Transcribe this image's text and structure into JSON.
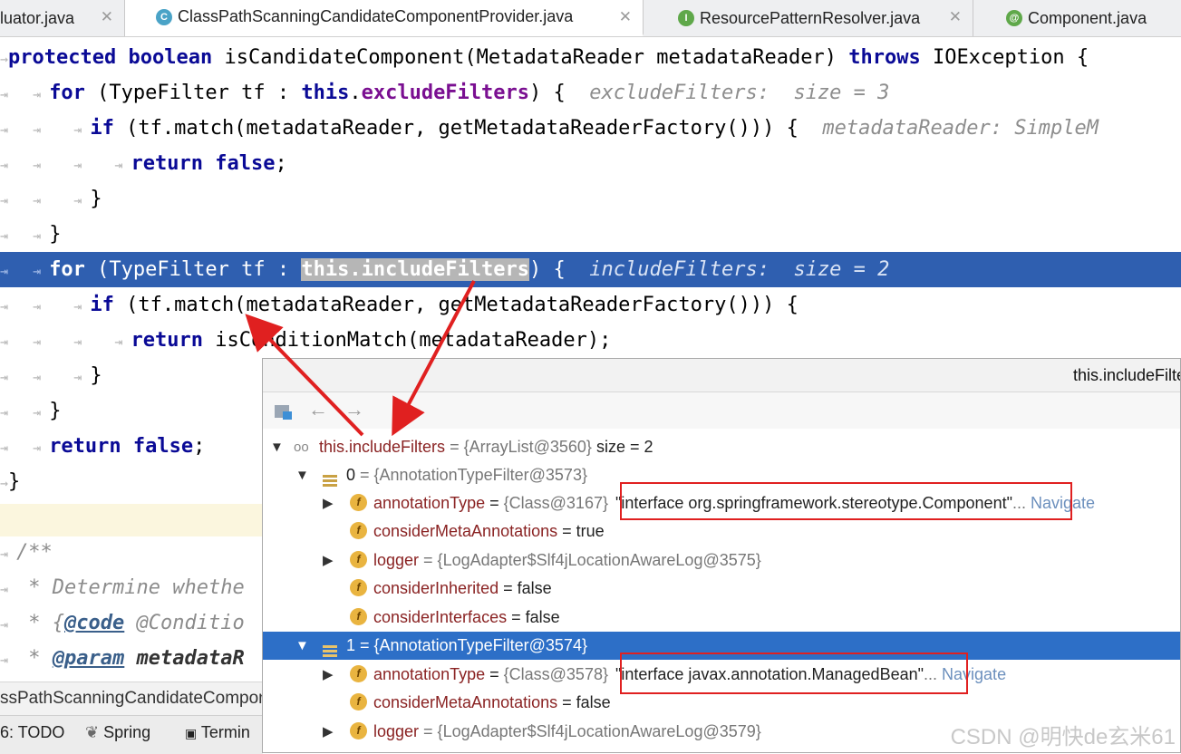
{
  "tabs": [
    {
      "label": "luator.java",
      "icon": "",
      "active": false
    },
    {
      "label": "ClassPathScanningCandidateComponentProvider.java",
      "icon": "C",
      "icon_color": "#4aa3c7",
      "active": true
    },
    {
      "label": "ResourcePatternResolver.java",
      "icon": "I",
      "icon_color": "#5fa84a",
      "active": false
    },
    {
      "label": "Component.java",
      "icon": "@",
      "icon_color": "#5fa84a",
      "active": false
    }
  ],
  "code": {
    "l1": {
      "kw1": "protected",
      "kw2": "boolean",
      "sig": " isCandidateComponent(MetadataReader metadataReader) ",
      "kw3": "throws",
      "tail": " IOException {"
    },
    "l2": {
      "kw": "for",
      "a": " (TypeFilter tf : ",
      "this": "this",
      "field": "excludeFilters",
      "b": ") {",
      "hint": "excludeFilters:  size = 3"
    },
    "l3": {
      "kw": "if",
      "a": " (tf.match(metadataReader, getMetadataReaderFactory())) {",
      "hint": "metadataReader: SimpleM"
    },
    "l4": {
      "kw1": "return",
      "kw2": "false",
      "b": ";"
    },
    "l5": "}",
    "l6": "}",
    "l7": {
      "kw": "for",
      "a": " (TypeFilter tf : ",
      "sel": "this.includeFilters",
      "b": ") {",
      "hint": "includeFilters:  size = 2"
    },
    "l8": {
      "kw": "if",
      "a": " (tf.match(metadataReader, getMetadataReaderFactory())) {"
    },
    "l9": {
      "kw": "return",
      "a": " isConditionMatch(metadataReader);"
    },
    "l10": "}",
    "l11": "}",
    "l12": {
      "kw1": "return",
      "kw2": "false",
      "b": ";"
    },
    "l13": "}"
  },
  "javadoc": {
    "c1": "/**",
    "c2": " * Determine whethe",
    "c3_a": " * {",
    "c3_tag": "@code",
    "c3_b": " @Conditio",
    "c4_tag": "@param",
    "c4_b": " metadataR"
  },
  "bottom": {
    "class_label": "ssPathScanningCandidateCompon",
    "todo": "6: TODO",
    "spring": "Spring",
    "terminal": "Termin"
  },
  "popup": {
    "title": "this.includeFilte",
    "root": {
      "name": "this.includeFilters",
      "type": " = {ArrayList@3560}",
      "extra": "  size = 2"
    },
    "items": [
      {
        "index": "0",
        "type": " = {AnnotationTypeFilter@3573}"
      },
      {
        "index": "1",
        "type": " = {AnnotationTypeFilter@3574}"
      }
    ],
    "item0": {
      "annotationType": {
        "name": "annotationType",
        "eq": " = ",
        "type": "{Class@3167}",
        "value": "\"interface org.springframework.stereotype.Component\"",
        "more": "...",
        "nav": "Navigate"
      },
      "considerMetaAnnotations": {
        "name": "considerMetaAnnotations",
        "value": " = true"
      },
      "logger": {
        "name": "logger",
        "value": " = {LogAdapter$Slf4jLocationAwareLog@3575}"
      },
      "considerInherited": {
        "name": "considerInherited",
        "value": " = false"
      },
      "considerInterfaces": {
        "name": "considerInterfaces",
        "value": " = false"
      }
    },
    "item1": {
      "annotationType": {
        "name": "annotationType",
        "eq": " = ",
        "type": "{Class@3578}",
        "value": "\"interface javax.annotation.ManagedBean\"",
        "more": "...",
        "nav": "Navigate"
      },
      "considerMetaAnnotations": {
        "name": "considerMetaAnnotations",
        "value": " = false"
      },
      "logger": {
        "name": "logger",
        "value": " = {LogAdapter$Slf4jLocationAwareLog@3579}"
      }
    }
  },
  "watermark": "CSDN @明快de玄米61",
  "colors": {
    "accent": "#2f5fb0",
    "selection": "#2d6fc7",
    "annotation_red": "#e02020"
  }
}
